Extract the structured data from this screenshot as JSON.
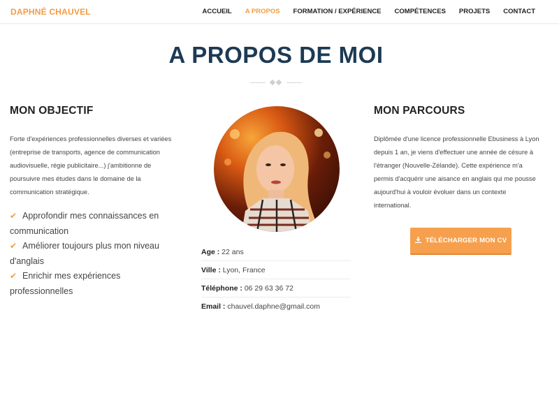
{
  "brand": "DAPHNÉ CHAUVEL",
  "nav": [
    {
      "label": "ACCUEIL",
      "active": false
    },
    {
      "label": "A PROPOS",
      "active": true
    },
    {
      "label": "FORMATION / EXPÉRIENCE",
      "active": false
    },
    {
      "label": "COMPÉTENCES",
      "active": false
    },
    {
      "label": "PROJETS",
      "active": false
    },
    {
      "label": "CONTACT",
      "active": false
    }
  ],
  "page_title": "A PROPOS DE MOI",
  "objectif": {
    "title": "MON OBJECTIF",
    "text": "Forte d'expériences professionnelles diverses et variées (entreprise de transports, agence de communication audiovisuelle, régie publicitaire...) j'ambitionne de poursuivre mes études dans le domaine de la communication stratégique.",
    "goals": [
      "Approfondir mes connaissances en communication",
      "Améliorer toujours plus mon niveau d'anglais",
      "Enrichir mes expériences professionnelles"
    ]
  },
  "info": [
    {
      "key": "Age :",
      "value": " 22 ans"
    },
    {
      "key": "Ville :",
      "value": " Lyon, France"
    },
    {
      "key": "Téléphone :",
      "value": " 06 29 63 36 72"
    },
    {
      "key": "Email :",
      "value": " chauvel.daphne@gmail.com"
    }
  ],
  "parcours": {
    "title": "MON PARCOURS",
    "text": "Diplômée d'une licence professionnelle Ebusiness à Lyon depuis 1 an, je viens d'effectuer une année de césure à l'étranger (Nouvelle-Zélande). Cette expérience m'a permis d'acquérir une aisance en anglais qui me pousse aujourd'hui à vouloir évoluer dans un contexte international."
  },
  "download_label": "TÉLÉCHARGER MON CV",
  "colors": {
    "accent": "#f39c45",
    "title": "#1c3a54"
  },
  "icons": {
    "goal": "check-icon",
    "download": "download-icon"
  }
}
